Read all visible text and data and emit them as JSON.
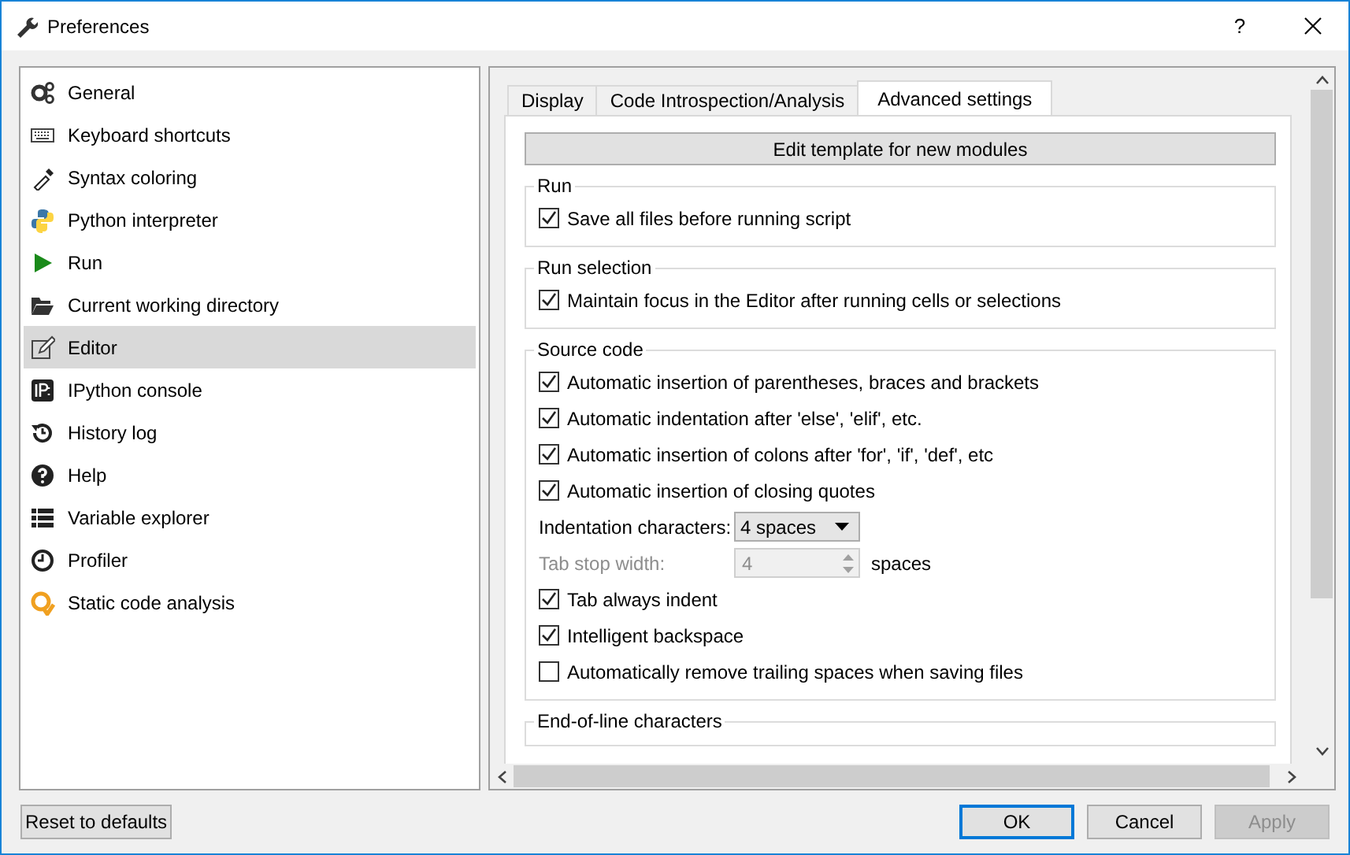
{
  "window": {
    "title": "Preferences",
    "help": "?"
  },
  "sidebar": {
    "items": [
      {
        "label": "General",
        "selected": false
      },
      {
        "label": "Keyboard shortcuts",
        "selected": false
      },
      {
        "label": "Syntax coloring",
        "selected": false
      },
      {
        "label": "Python interpreter",
        "selected": false
      },
      {
        "label": "Run",
        "selected": false
      },
      {
        "label": "Current working directory",
        "selected": false
      },
      {
        "label": "Editor",
        "selected": true
      },
      {
        "label": "IPython console",
        "selected": false
      },
      {
        "label": "History log",
        "selected": false
      },
      {
        "label": "Help",
        "selected": false
      },
      {
        "label": "Variable explorer",
        "selected": false
      },
      {
        "label": "Profiler",
        "selected": false
      },
      {
        "label": "Static code analysis",
        "selected": false
      }
    ]
  },
  "tabs": [
    {
      "label": "Display",
      "selected": false
    },
    {
      "label": "Code Introspection/Analysis",
      "selected": false
    },
    {
      "label": "Advanced settings",
      "selected": true
    }
  ],
  "template_button": "Edit template for new modules",
  "groups": [
    {
      "title": "Run",
      "items": [
        {
          "kind": "checkbox",
          "label": "Save all files before running script",
          "checked": true
        }
      ]
    },
    {
      "title": "Run selection",
      "items": [
        {
          "kind": "checkbox",
          "label": "Maintain focus in the Editor after running cells or selections",
          "checked": true
        }
      ]
    },
    {
      "title": "Source code",
      "items": [
        {
          "kind": "checkbox",
          "label": "Automatic insertion of parentheses, braces and brackets",
          "checked": true
        },
        {
          "kind": "checkbox",
          "label": "Automatic indentation after 'else', 'elif', etc.",
          "checked": true
        },
        {
          "kind": "checkbox",
          "label": "Automatic insertion of colons after 'for', 'if', 'def', etc",
          "checked": true
        },
        {
          "kind": "checkbox",
          "label": "Automatic insertion of closing quotes",
          "checked": true
        },
        {
          "kind": "combo",
          "label": "Indentation characters:",
          "value": "4 spaces"
        },
        {
          "kind": "spin",
          "label": "Tab stop width:",
          "value": "4",
          "suffix": "spaces",
          "disabled": true
        },
        {
          "kind": "checkbox",
          "label": "Tab always indent",
          "checked": true
        },
        {
          "kind": "checkbox",
          "label": "Intelligent backspace",
          "checked": true
        },
        {
          "kind": "checkbox",
          "label": "Automatically remove trailing spaces when saving files",
          "checked": false
        }
      ]
    },
    {
      "title": "End-of-line characters"
    }
  ],
  "footer": {
    "reset_button": "Reset to defaults",
    "buttons": [
      {
        "label": "OK",
        "default": true,
        "disabled": false
      },
      {
        "label": "Cancel",
        "default": false,
        "disabled": false
      },
      {
        "label": "Apply",
        "default": false,
        "disabled": true
      }
    ]
  }
}
